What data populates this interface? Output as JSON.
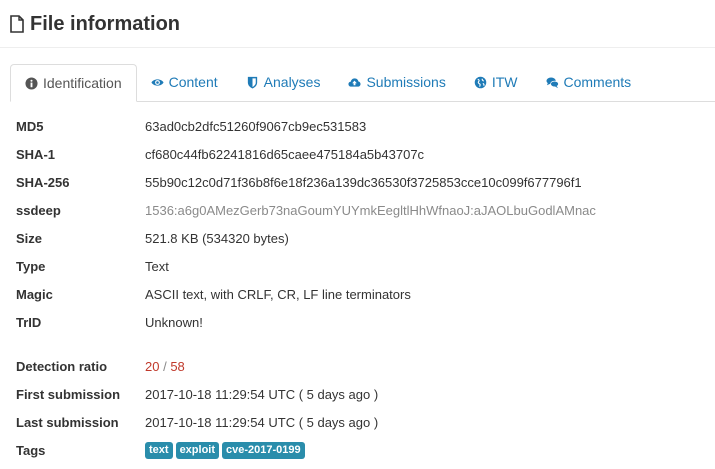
{
  "header": {
    "title": "File information",
    "icon": "file-icon"
  },
  "tabs": [
    {
      "label": "Identification",
      "icon": "info-circle-icon",
      "active": true
    },
    {
      "label": "Content",
      "icon": "eye-icon",
      "active": false
    },
    {
      "label": "Analyses",
      "icon": "shield-icon",
      "active": false
    },
    {
      "label": "Submissions",
      "icon": "cloud-upload-icon",
      "active": false
    },
    {
      "label": "ITW",
      "icon": "globe-icon",
      "active": false
    },
    {
      "label": "Comments",
      "icon": "comments-icon",
      "active": false
    }
  ],
  "info": {
    "md5": {
      "label": "MD5",
      "value": "63ad0cb2dfc51260f9067cb9ec531583"
    },
    "sha1": {
      "label": "SHA-1",
      "value": "cf680c44fb62241816d65caee475184a5b43707c"
    },
    "sha256": {
      "label": "SHA-256",
      "value": "55b90c12c0d71f36b8f6e18f236a139dc36530f3725853cce10c099f677796f1"
    },
    "ssdeep": {
      "label": "ssdeep",
      "value": "1536:a6g0AMezGerb73naGoumYUYmkEegltlHhWfnaoJ:aJAOLbuGodlAMnac"
    },
    "size": {
      "label": "Size",
      "value": "521.8 KB (534320 bytes)"
    },
    "type": {
      "label": "Type",
      "value": "Text"
    },
    "magic": {
      "label": "Magic",
      "value": "ASCII text, with CRLF, CR, LF line terminators"
    },
    "trid": {
      "label": "TrID",
      "value": "Unknown!"
    },
    "detection": {
      "label": "Detection ratio",
      "positives": "20",
      "separator": " / ",
      "total": "58"
    },
    "first_submission": {
      "label": "First submission",
      "value": "2017-10-18 11:29:54 UTC ( 5 days ago )"
    },
    "last_submission": {
      "label": "Last submission",
      "value": "2017-10-18 11:29:54 UTC ( 5 days ago )"
    },
    "tags": {
      "label": "Tags",
      "items": [
        "text",
        "exploit",
        "cve-2017-0199"
      ]
    }
  },
  "colors": {
    "link": "#1f7bb7",
    "detection": "#c0392b",
    "tag_bg": "#2a8dab"
  }
}
